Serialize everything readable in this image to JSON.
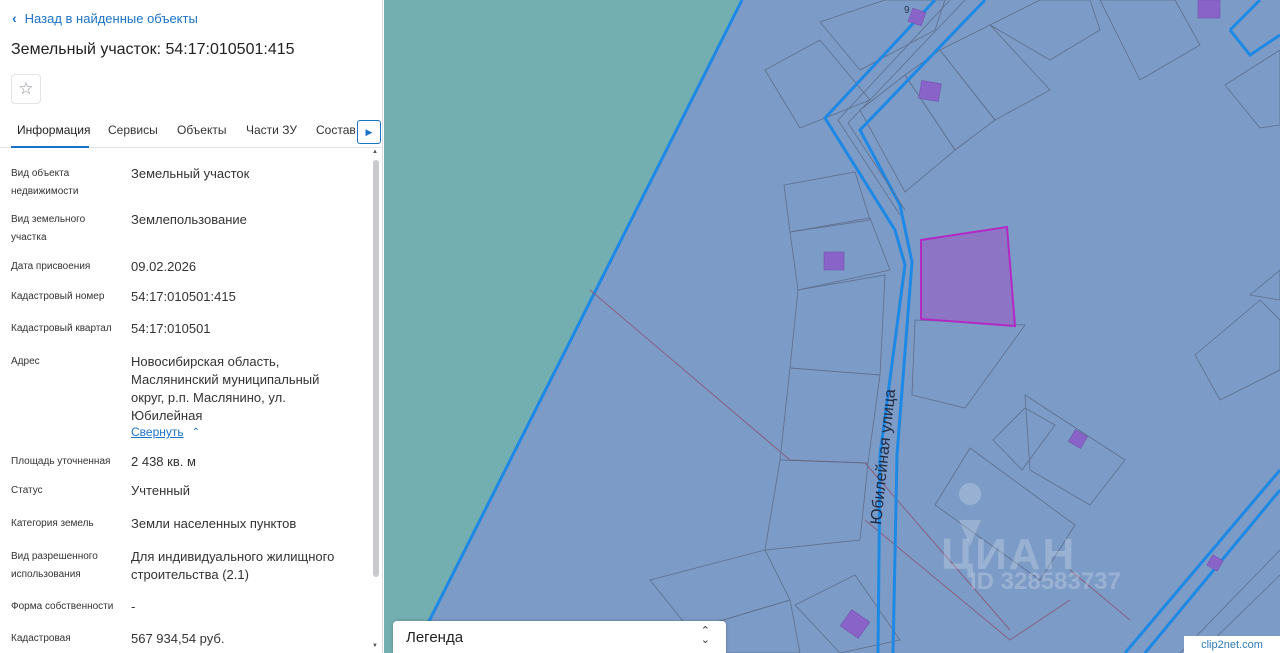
{
  "panel": {
    "back_label": "Назад в найденные объекты",
    "title": "Земельный участок: 54:17:010501:415",
    "favorite_icon": "star-icon",
    "tabs": [
      {
        "label": "Информация",
        "active": true
      },
      {
        "label": "Сервисы"
      },
      {
        "label": "Объекты"
      },
      {
        "label": "Части ЗУ"
      },
      {
        "label": "Состав"
      }
    ],
    "fields": [
      {
        "label": "Вид объекта недвижимости",
        "value": "Земельный участок"
      },
      {
        "label": "Вид земельного участка",
        "value": "Землепользование"
      },
      {
        "label": "Дата присвоения",
        "value": "09.02.2026"
      },
      {
        "label": "Кадастровый номер",
        "value": "54:17:010501:415"
      },
      {
        "label": "Кадастровый квартал",
        "value": "54:17:010501"
      },
      {
        "label": "Адрес",
        "value": "Новосибирская область, Маслянинский муниципальный округ, р.п. Маслянино, ул. Юбилейная"
      },
      {
        "label": "Площадь уточненная",
        "value": "2 438 кв. м"
      },
      {
        "label": "Статус",
        "value": "Учтенный"
      },
      {
        "label": "Категория земель",
        "value": "Земли населенных пунктов"
      },
      {
        "label": "Вид разрешенного использования",
        "value": "Для индивидуального жилищного строительства (2.1)"
      },
      {
        "label": "Форма собственности",
        "value": "-"
      },
      {
        "label": "Кадастровая",
        "value": "567 934,54 руб."
      }
    ],
    "collapse_label": "Свернуть"
  },
  "map": {
    "street_label": "Юбилейная улица",
    "house_number": "9",
    "watermark": "ЦИАН",
    "watermark_id": "ID 328583737",
    "legend_label": "Легенда",
    "attribution": "clip2net.com",
    "colors": {
      "water": "#73afb0",
      "land": "#7c9bc6",
      "boundary": "#1e88e5",
      "parcel_line": "#8a5a7a",
      "selected_fill": "#8e74c4",
      "selected_stroke": "#b22ac4",
      "building": "#8a63c8"
    }
  }
}
